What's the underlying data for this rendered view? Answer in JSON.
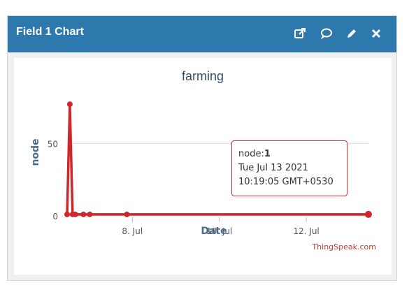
{
  "widget": {
    "title": "Field 1 Chart",
    "header_color": "#2d79ae",
    "icons": [
      "external-link-icon",
      "comment-icon",
      "pencil-icon",
      "close-icon"
    ]
  },
  "chart": {
    "title": "farming",
    "credit": "ThingSpeak.com",
    "tooltip": {
      "label": "node:",
      "value": "1",
      "date": "Tue Jul 13 2021",
      "time": "10:19:05 GMT+0530"
    }
  },
  "chart_data": {
    "type": "line",
    "title": "farming",
    "xlabel": "Date",
    "ylabel": "node",
    "x_tick_labels": [
      "8. Jul",
      "10. Jul",
      "12. Jul"
    ],
    "y_tick_labels": [
      "0",
      "50"
    ],
    "ylim": [
      0,
      80
    ],
    "grid": true,
    "line_color": "#d0252b",
    "series": [
      {
        "x": [
          "2021-07-06 12:00",
          "2021-07-06 13:30",
          "2021-07-06 15:00",
          "2021-07-06 16:30",
          "2021-07-06 21:00",
          "2021-07-07 00:30",
          "2021-07-07 21:00",
          "2021-07-13 10:19"
        ],
        "values": [
          1,
          77,
          1,
          1,
          1,
          1,
          1,
          1
        ]
      }
    ]
  }
}
